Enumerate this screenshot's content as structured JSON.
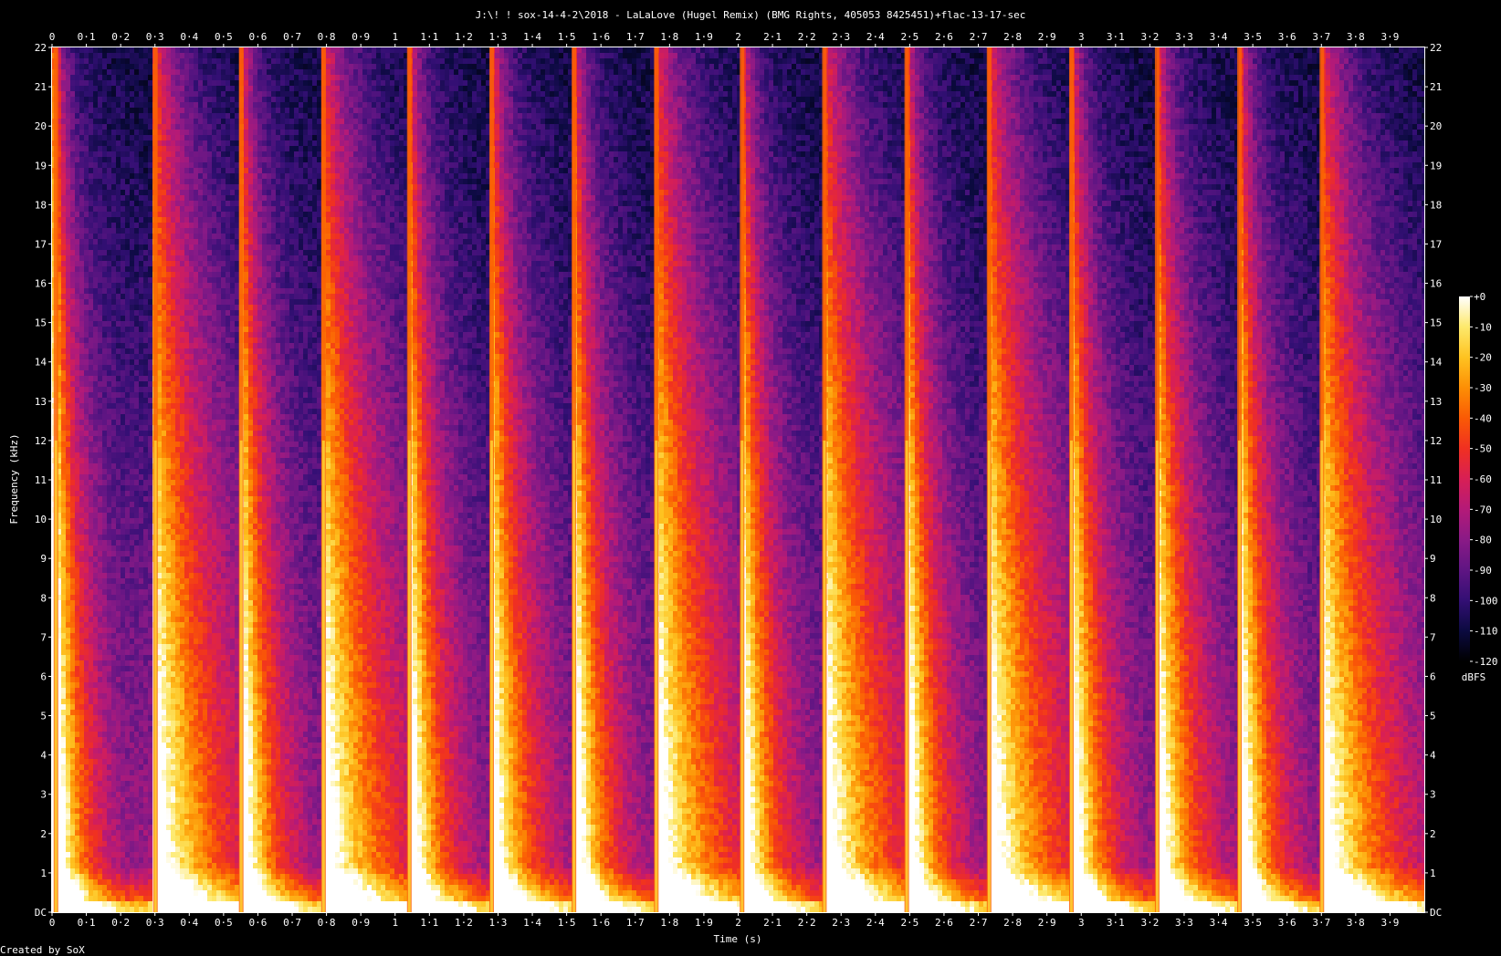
{
  "chart_data": {
    "type": "heatmap",
    "title": "J:\\! ! sox-14-4-2\\2018 - LaLaLove (Hugel Remix) (BMG Rights, 405053 8425451)+flac-13-17-sec",
    "xlabel": "Time (s)",
    "ylabel": "Frequency (kHz)",
    "xlim": [
      0,
      4.0
    ],
    "ylim": [
      0,
      22
    ],
    "x_ticks": [
      "0",
      "0·1",
      "0·2",
      "0·3",
      "0·4",
      "0·5",
      "0·6",
      "0·7",
      "0·8",
      "0·9",
      "1",
      "1·1",
      "1·2",
      "1·3",
      "1·4",
      "1·5",
      "1·6",
      "1·7",
      "1·8",
      "1·9",
      "2",
      "2·1",
      "2·2",
      "2·3",
      "2·4",
      "2·5",
      "2·6",
      "2·7",
      "2·8",
      "2·9",
      "3",
      "3·1",
      "3·2",
      "3·3",
      "3·4",
      "3·5",
      "3·6",
      "3·7",
      "3·8",
      "3·9"
    ],
    "y_ticks": [
      "DC",
      "1",
      "2",
      "3",
      "4",
      "5",
      "6",
      "7",
      "8",
      "9",
      "10",
      "11",
      "12",
      "13",
      "14",
      "15",
      "16",
      "17",
      "18",
      "19",
      "20",
      "21",
      "22"
    ],
    "colorbar": {
      "label": "dBFS",
      "range": [
        -120,
        0
      ],
      "ticks": [
        "+0",
        "-10",
        "-20",
        "-30",
        "-40",
        "-50",
        "-60",
        "-70",
        "-80",
        "-90",
        "-100",
        "-110",
        "-120"
      ],
      "colors": [
        "#000000",
        "#0b0a40",
        "#330f74",
        "#5f1583",
        "#8a1a86",
        "#b41a78",
        "#d81f55",
        "#f03021",
        "#fa5a05",
        "#fd8f05",
        "#fec321",
        "#fde96c",
        "#ffffff"
      ]
    },
    "onsets": [
      {
        "t": 0.01,
        "dur": 0.09,
        "strength": 1.0
      },
      {
        "t": 0.3,
        "dur": 0.22,
        "strength": 0.9
      },
      {
        "t": 0.55,
        "dur": 0.1,
        "strength": 1.0
      },
      {
        "t": 0.79,
        "dur": 0.22,
        "strength": 0.9
      },
      {
        "t": 1.04,
        "dur": 0.1,
        "strength": 1.0
      },
      {
        "t": 1.28,
        "dur": 0.12,
        "strength": 0.95
      },
      {
        "t": 1.52,
        "dur": 0.1,
        "strength": 1.0
      },
      {
        "t": 1.76,
        "dur": 0.22,
        "strength": 0.9
      },
      {
        "t": 2.01,
        "dur": 0.1,
        "strength": 1.0
      },
      {
        "t": 2.25,
        "dur": 0.22,
        "strength": 0.9
      },
      {
        "t": 2.49,
        "dur": 0.1,
        "strength": 1.0
      },
      {
        "t": 2.73,
        "dur": 0.22,
        "strength": 0.9
      },
      {
        "t": 2.97,
        "dur": 0.1,
        "strength": 1.0
      },
      {
        "t": 3.22,
        "dur": 0.12,
        "strength": 0.95
      },
      {
        "t": 3.46,
        "dur": 0.1,
        "strength": 1.0
      },
      {
        "t": 3.7,
        "dur": 0.22,
        "strength": 0.9
      }
    ]
  },
  "footer": {
    "credit": "Created by SoX"
  }
}
